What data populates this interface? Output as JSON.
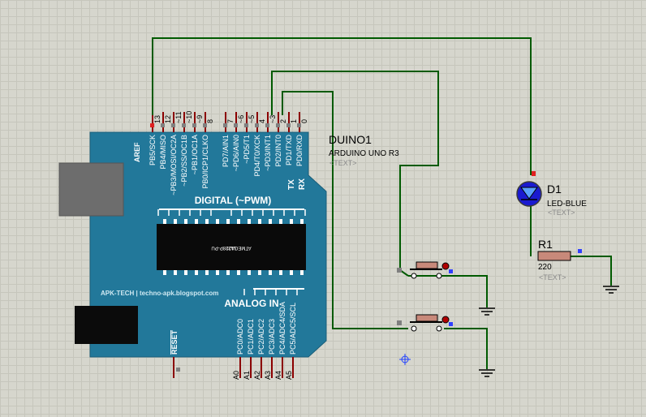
{
  "arduino": {
    "ref": "DUINO1",
    "model": "ARDUINO UNO R3",
    "text_placeholder": "<TEXT>",
    "digital_label": "DIGITAL (~PWM)",
    "analog_label": "ANALOG IN",
    "brand": "APK-TECH | techno-apk.blogspot.com",
    "chip_label": "ATMEGA328P-PU",
    "chip_code": "1121",
    "reset_label": "RESET",
    "aref_label": "AREF",
    "tx_label": "TX",
    "rx_label": "RX",
    "digital_pin_numbers": [
      "13",
      "12",
      "~11",
      "~10",
      "~9",
      "8",
      "7",
      "~6",
      "~5",
      "4",
      "~3",
      "2",
      "1",
      "0"
    ],
    "digital_pin_names": [
      "PB5/SCK",
      "PB4/MISO",
      "~PB3/MOSI/OC2A",
      "~PB2/SS/OC1B",
      "~PB1/OC1A",
      "PB0/ICP1/CLKO",
      "PD7/AIN1",
      "~PD6/AIN0",
      "~PD5/T1",
      "PD4/T0/XCK",
      "~PD3/INT1",
      "PD2/INT0",
      "PD1/TXD",
      "PD0/RXD"
    ],
    "analog_pin_numbers": [
      "A0",
      "A1",
      "A2",
      "A3",
      "A4",
      "A5"
    ],
    "analog_pin_names": [
      "PC0/ADC0",
      "PC1/ADC1",
      "PC2/ADC2",
      "PC3/ADC3",
      "PC4/ADC4/SDA",
      "PC5/ADC5/SCL"
    ]
  },
  "led": {
    "ref": "D1",
    "type": "LED-BLUE",
    "text_placeholder": "<TEXT>"
  },
  "resistor": {
    "ref": "R1",
    "value": "220",
    "text_placeholder": "<TEXT>"
  },
  "colors": {
    "board": "#22789a",
    "wire": "#005a00",
    "pin": "#8b0000",
    "led_body": "#1a1ad0",
    "resistor": "#c8897a"
  }
}
